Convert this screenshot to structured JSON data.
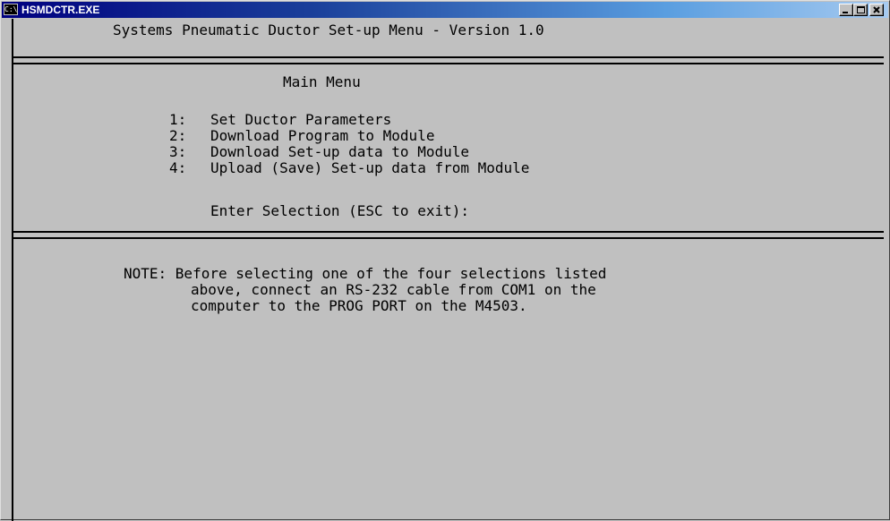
{
  "window": {
    "title": "HSMDCTR.EXE",
    "icon": "console-icon",
    "controls": [
      "minimize-icon",
      "maximize-icon",
      "close-icon"
    ]
  },
  "console": {
    "header": "Systems Pneumatic Ductor Set-up Menu - Version 1.0",
    "menu_title": "Main Menu",
    "items": [
      {
        "number": "1:",
        "label": "Set Ductor Parameters"
      },
      {
        "number": "2:",
        "label": "Download Program to Module"
      },
      {
        "number": "3:",
        "label": "Download Set-up data to Module"
      },
      {
        "number": "4:",
        "label": "Upload (Save) Set-up data from Module"
      }
    ],
    "prompt": "Enter Selection (ESC to exit):",
    "note_lines": [
      "NOTE: Before selecting one of the four selections listed",
      "above, connect an RS-232 cable from COM1 on the",
      "computer to the PROG PORT on the M4503."
    ]
  }
}
